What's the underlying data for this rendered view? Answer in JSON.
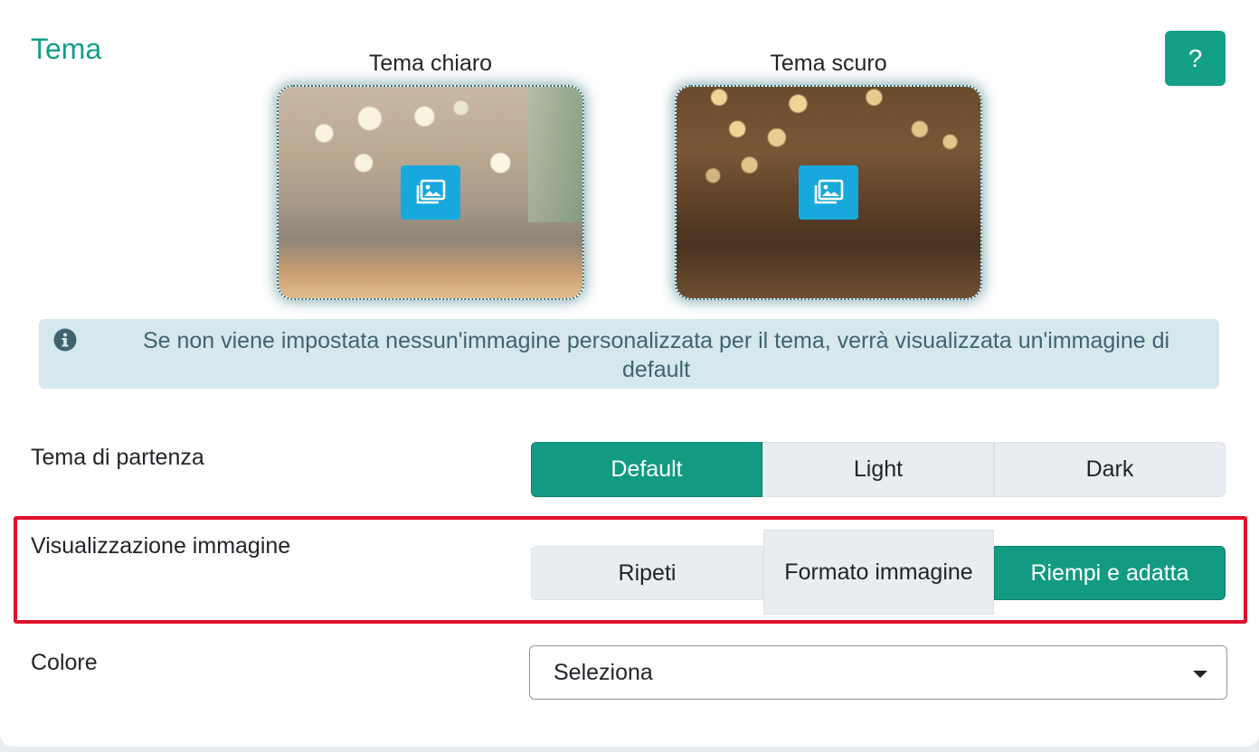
{
  "section": {
    "title": "Tema",
    "help_label": "?"
  },
  "themes": [
    {
      "label": "Tema chiaro"
    },
    {
      "label": "Tema scuro"
    }
  ],
  "info": {
    "text": "Se non viene impostata nessun'immagine personalizzata per il tema, verrà visualizzata un'immagine di default"
  },
  "start_theme": {
    "label": "Tema di partenza",
    "options": [
      "Default",
      "Light",
      "Dark"
    ],
    "selected": "Default"
  },
  "image_display": {
    "label": "Visualizzazione immagine",
    "options": [
      "Ripeti",
      "Formato immagine",
      "Riempi e adatta"
    ],
    "selected": "Riempi e adatta"
  },
  "color": {
    "label": "Colore",
    "value": "Seleziona"
  },
  "colors": {
    "accent": "#13a087",
    "info_bg": "#d5e8ee",
    "image_button": "#17a9dd",
    "highlight": "#e0102c"
  },
  "icons": {
    "help": "question-mark",
    "image_upload": "images-icon",
    "info": "info-circle-icon",
    "caret": "caret-down-icon"
  }
}
